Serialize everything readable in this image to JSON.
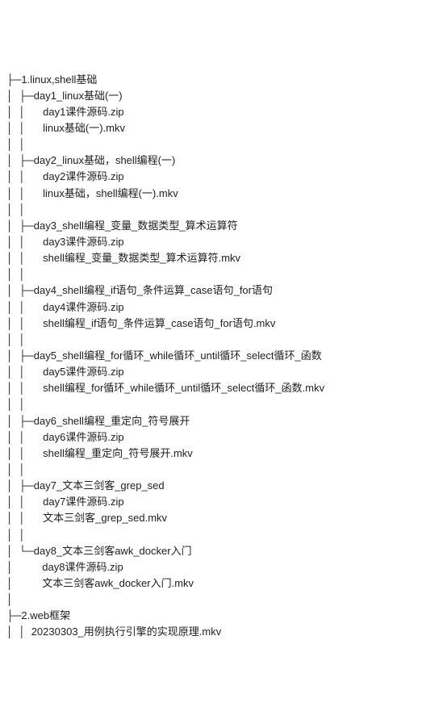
{
  "tree": [
    {
      "prefix": "├─",
      "text": "1.linux,shell基础"
    },
    {
      "prefix": "│  ├─",
      "text": "day1_linux基础(一)"
    },
    {
      "prefix": "│  │      ",
      "text": "day1课件源码.zip"
    },
    {
      "prefix": "│  │      ",
      "text": "linux基础(一).mkv"
    },
    {
      "prefix": "│  │      ",
      "text": ""
    },
    {
      "prefix": "│  ├─",
      "text": "day2_linux基础，shell编程(一)"
    },
    {
      "prefix": "│  │      ",
      "text": "day2课件源码.zip"
    },
    {
      "prefix": "│  │      ",
      "text": "linux基础，shell编程(一).mkv"
    },
    {
      "prefix": "│  │      ",
      "text": ""
    },
    {
      "prefix": "│  ├─",
      "text": "day3_shell编程_变量_数据类型_算术运算符"
    },
    {
      "prefix": "│  │      ",
      "text": "day3课件源码.zip"
    },
    {
      "prefix": "│  │      ",
      "text": "shell编程_变量_数据类型_算术运算符.mkv"
    },
    {
      "prefix": "│  │      ",
      "text": ""
    },
    {
      "prefix": "│  ├─",
      "text": "day4_shell编程_if语句_条件运算_case语句_for语句"
    },
    {
      "prefix": "│  │      ",
      "text": "day4课件源码.zip"
    },
    {
      "prefix": "│  │      ",
      "text": "shell编程_if语句_条件运算_case语句_for语句.mkv"
    },
    {
      "prefix": "│  │      ",
      "text": ""
    },
    {
      "prefix": "│  ├─",
      "text": "day5_shell编程_for循环_while循环_until循环_select循环_函数"
    },
    {
      "prefix": "│  │      ",
      "text": "day5课件源码.zip"
    },
    {
      "prefix": "│  │      ",
      "text": "shell编程_for循环_while循环_until循环_select循环_函数.mkv"
    },
    {
      "prefix": "│  │      ",
      "text": ""
    },
    {
      "prefix": "│  ├─",
      "text": "day6_shell编程_重定向_符号展开"
    },
    {
      "prefix": "│  │      ",
      "text": "day6课件源码.zip"
    },
    {
      "prefix": "│  │      ",
      "text": "shell编程_重定向_符号展开.mkv"
    },
    {
      "prefix": "│  │      ",
      "text": ""
    },
    {
      "prefix": "│  ├─",
      "text": "day7_文本三剑客_grep_sed"
    },
    {
      "prefix": "│  │      ",
      "text": "day7课件源码.zip"
    },
    {
      "prefix": "│  │      ",
      "text": "文本三剑客_grep_sed.mkv"
    },
    {
      "prefix": "│  │      ",
      "text": ""
    },
    {
      "prefix": "│  └─",
      "text": "day8_文本三剑客awk_docker入门"
    },
    {
      "prefix": "│          ",
      "text": "day8课件源码.zip"
    },
    {
      "prefix": "│          ",
      "text": "文本三剑客awk_docker入门.mkv"
    },
    {
      "prefix": "│          ",
      "text": ""
    },
    {
      "prefix": "├─",
      "text": "2.web框架"
    },
    {
      "prefix": "│  │  ",
      "text": "20230303_用例执行引擎的实现原理.mkv"
    }
  ]
}
